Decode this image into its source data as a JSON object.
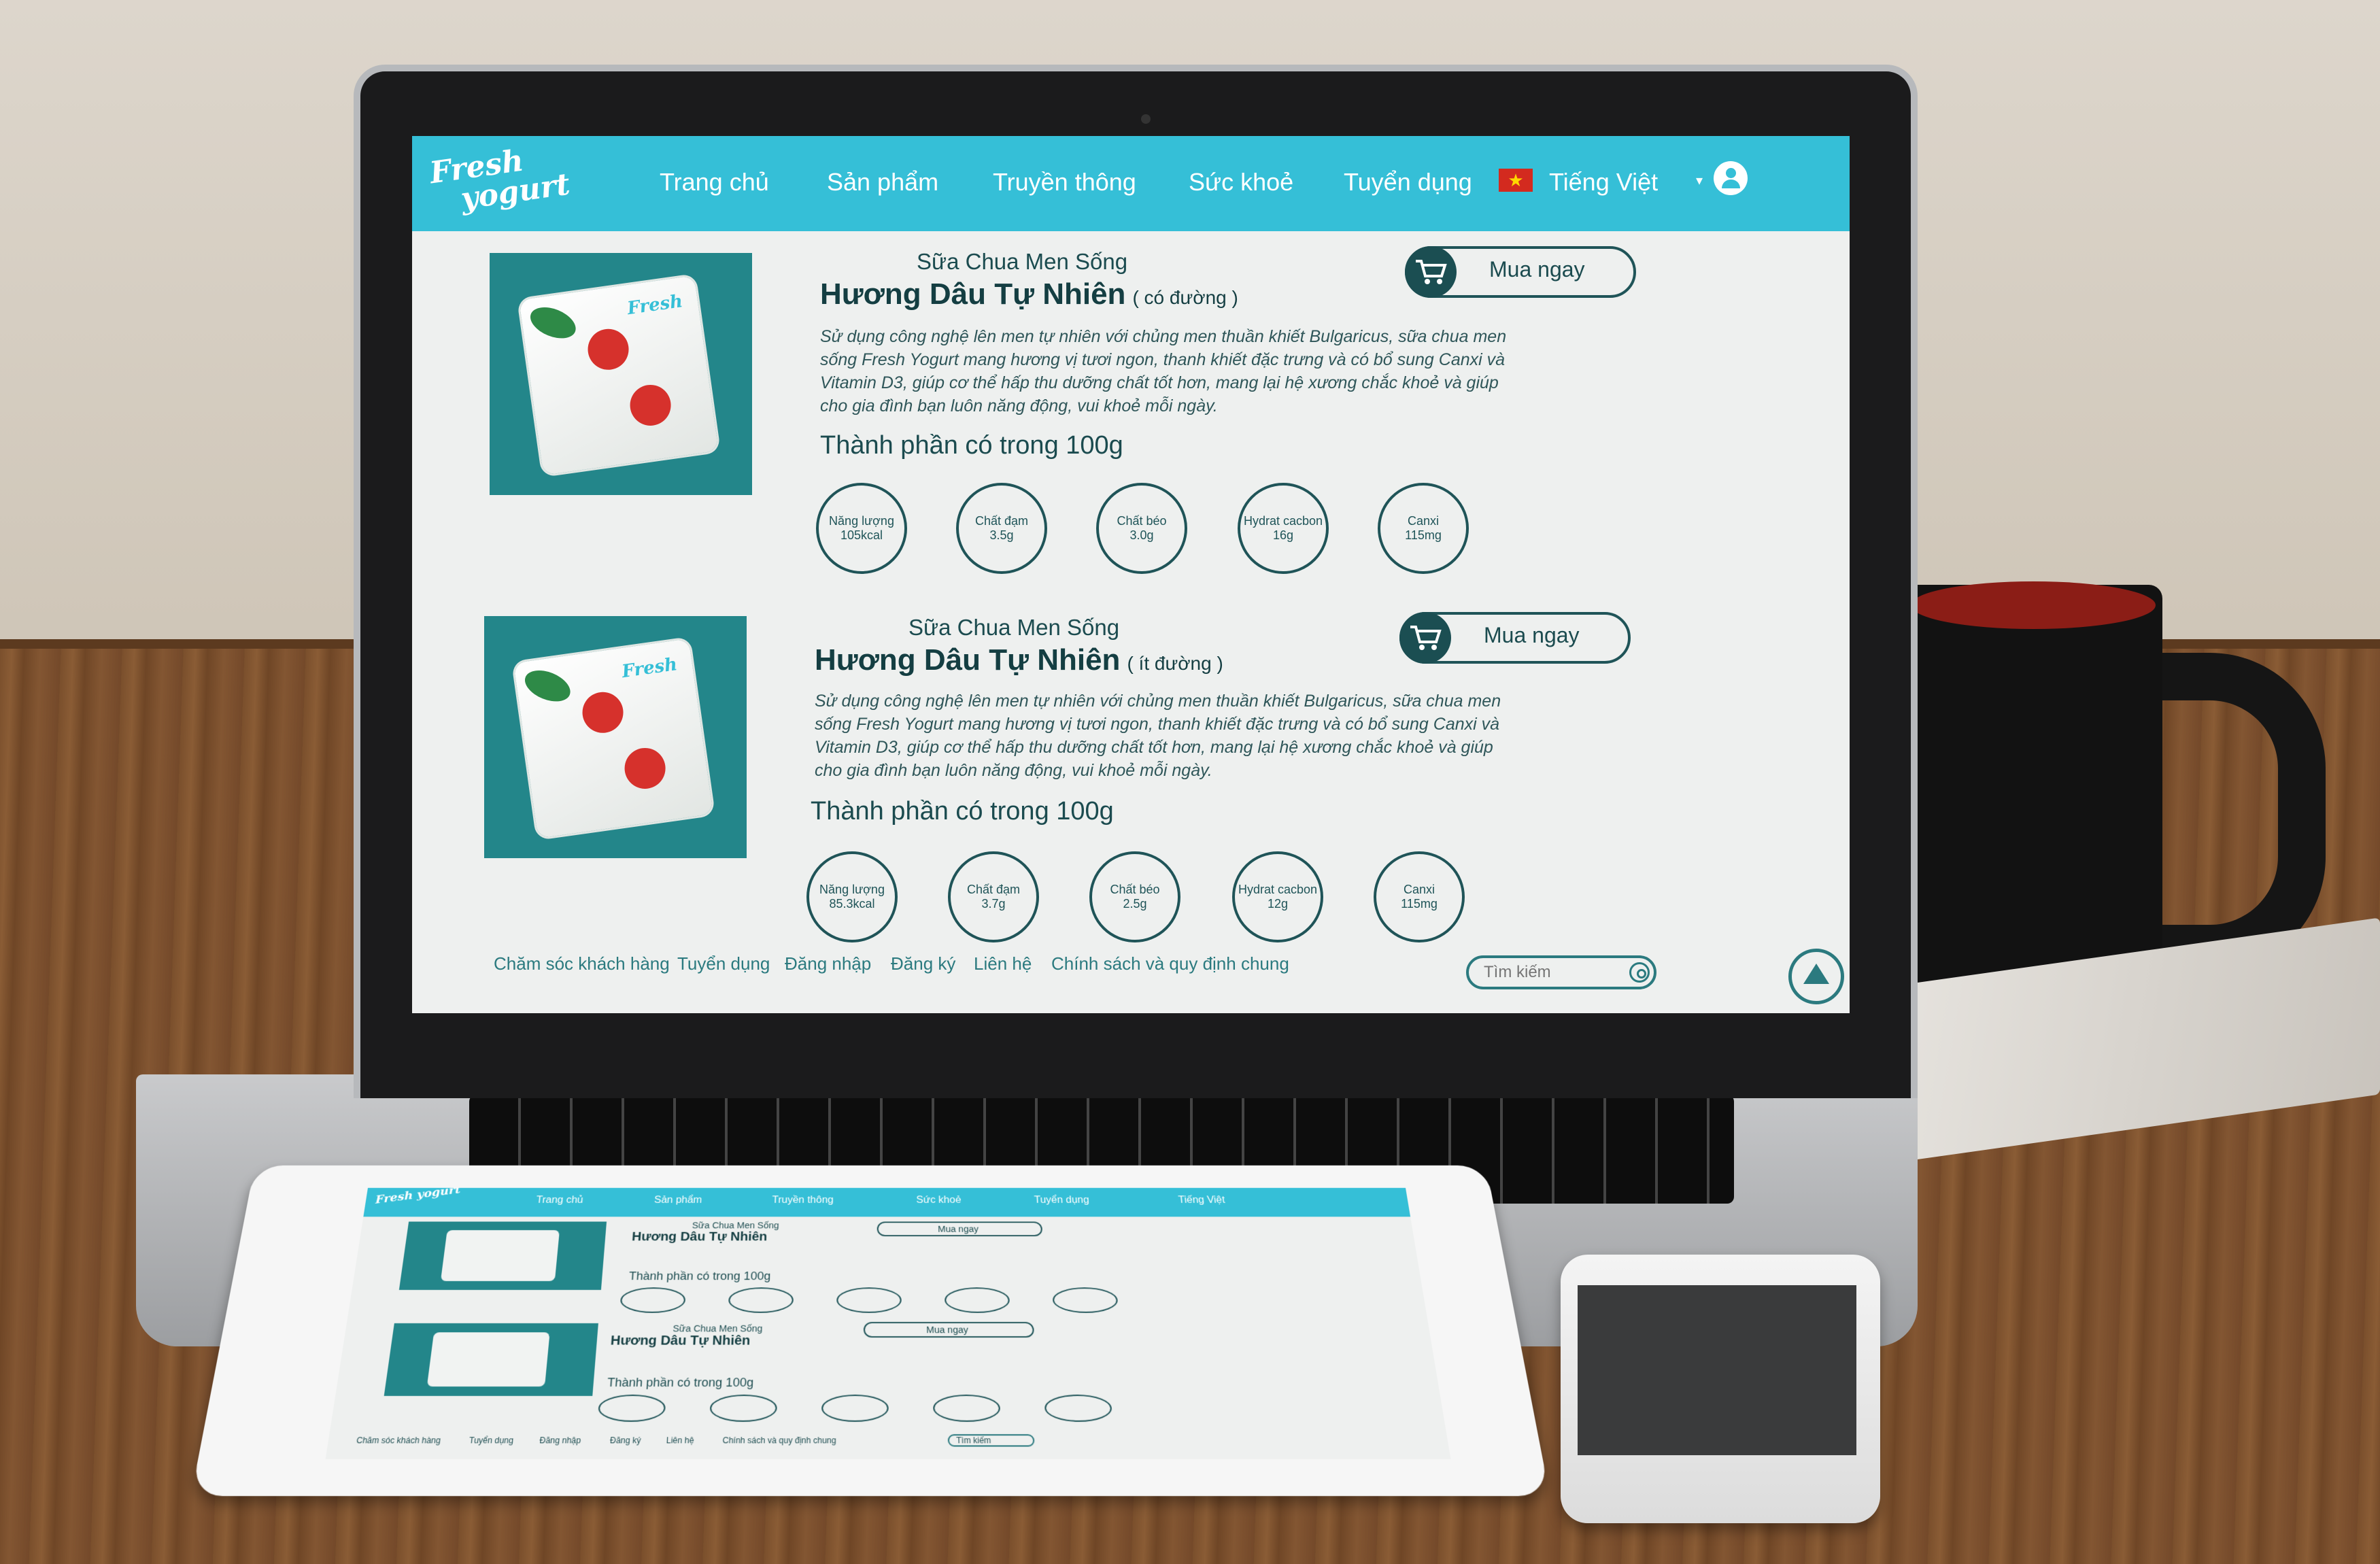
{
  "nav": {
    "logo_line1": "Fresh",
    "logo_line2": "yogurt",
    "items": [
      "Trang chủ",
      "Sản phẩm",
      "Truyền thông",
      "Sức khoẻ",
      "Tuyển dụng"
    ],
    "language": "Tiếng Việt"
  },
  "products": [
    {
      "subtitle": "Sữa Chua Men Sống",
      "title": "Hương Dâu Tự Nhiên",
      "variant": "( có đường )",
      "description": "Sử dụng công nghệ lên men tự nhiên với chủng men thuần khiết Bulgaricus, sữa chua men sống Fresh Yogurt mang hương vị tươi ngon, thanh khiết đặc trưng và có bổ sung Canxi và Vitamin D3, giúp cơ thể hấp thu dưỡng chất tốt hơn, mang lại hệ xương chắc khoẻ và giúp cho gia đình bạn luôn năng động, vui khoẻ mỗi ngày.",
      "section": "Thành phần có trong 100g",
      "buy_label": "Mua ngay",
      "nutrients": [
        {
          "name": "Năng lượng",
          "value": "105kcal"
        },
        {
          "name": "Chất đạm",
          "value": "3.5g"
        },
        {
          "name": "Chất béo",
          "value": "3.0g"
        },
        {
          "name": "Hydrat cacbon",
          "value": "16g"
        },
        {
          "name": "Canxi",
          "value": "115mg"
        }
      ]
    },
    {
      "subtitle": "Sữa Chua Men Sống",
      "title": "Hương Dâu Tự Nhiên",
      "variant": "( ít đường )",
      "description": "Sử dụng công nghệ lên men tự nhiên với chủng men thuần khiết Bulgaricus, sữa chua men sống Fresh Yogurt mang hương vị tươi ngon, thanh khiết đặc trưng và có bổ sung Canxi và Vitamin D3, giúp cơ thể hấp thu dưỡng chất tốt hơn, mang lại hệ xương chắc khoẻ và giúp cho gia đình bạn luôn năng động, vui khoẻ mỗi ngày.",
      "section": "Thành phần có trong 100g",
      "buy_label": "Mua ngay",
      "nutrients": [
        {
          "name": "Năng lượng",
          "value": "85.3kcal"
        },
        {
          "name": "Chất đạm",
          "value": "3.7g"
        },
        {
          "name": "Chất béo",
          "value": "2.5g"
        },
        {
          "name": "Hydrat cacbon",
          "value": "12g"
        },
        {
          "name": "Canxi",
          "value": "115mg"
        }
      ]
    }
  ],
  "footer": {
    "links": [
      "Chăm sóc khách hàng",
      "Tuyển dụng",
      "Đăng nhập",
      "Đăng ký",
      "Liên hệ",
      "Chính sách và quy định chung"
    ],
    "search_placeholder": "Tìm kiếm"
  },
  "colors": {
    "nav": "#35bfd7",
    "accent": "#1f5458",
    "product_bg": "#23868a"
  }
}
